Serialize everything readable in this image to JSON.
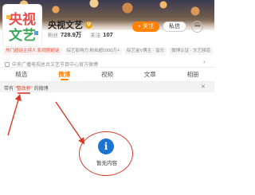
{
  "profile": {
    "name": "央视文艺",
    "verified_badge": "V",
    "avatar_text_1": "央视",
    "avatar_text_2": "文艺",
    "fans_label": "粉丝",
    "fans_value": "728.9万",
    "following_label": "关注",
    "following_value": "107"
  },
  "actions": {
    "follow_label": "+ 关注",
    "chat_label": "私信",
    "more_label": "•••"
  },
  "tags": [
    {
      "text": "热门超话主持人 影视剧超话",
      "color": "red"
    },
    {
      "text": "综艺影响力 粉丝超1000万+",
      "color": "red"
    },
    {
      "text": "综艺金V博主 · 音乐",
      "color": "red"
    },
    {
      "text": "微博认证 · 文艺频道",
      "color": "red"
    }
  ],
  "description": "中央广播电视总台文艺节目中心官方微博",
  "tabs": [
    {
      "label": "精选",
      "active": false
    },
    {
      "label": "微博",
      "active": true
    },
    {
      "label": "视频",
      "active": false
    },
    {
      "label": "文章",
      "active": false
    },
    {
      "label": "相册",
      "active": false
    }
  ],
  "filter": {
    "prefix": "带有 ",
    "highlight": "\"整改杯\"",
    "suffix": " 的微博",
    "close_icon": "close-icon"
  },
  "empty_state": {
    "icon": "info-icon",
    "text": "暂无内容"
  },
  "colors": {
    "accent": "#ff8200",
    "annotation": "#d83a2a",
    "info": "#1c74d2"
  }
}
